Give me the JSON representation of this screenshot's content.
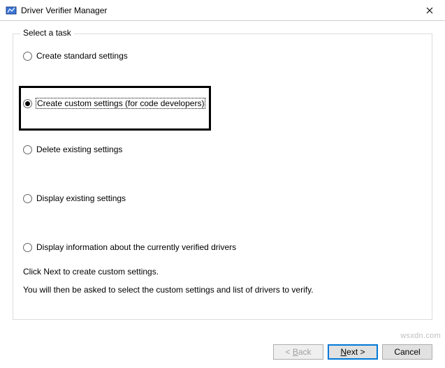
{
  "window": {
    "title": "Driver Verifier Manager"
  },
  "groupbox": {
    "label": "Select a task",
    "options": [
      {
        "label": "Create standard settings",
        "checked": false
      },
      {
        "label": "Create custom settings (for code developers)",
        "checked": true
      },
      {
        "label": "Delete existing settings",
        "checked": false
      },
      {
        "label": "Display existing settings",
        "checked": false
      },
      {
        "label": "Display information about the currently verified drivers",
        "checked": false
      }
    ],
    "selected_index": 1
  },
  "instructions": {
    "line1": "Click Next to create custom settings.",
    "line2": "You will then be asked to select the custom settings and list of drivers to verify."
  },
  "buttons": {
    "back": "< Back",
    "next": "Next >",
    "cancel": "Cancel",
    "back_enabled": false,
    "next_enabled": true,
    "cancel_enabled": true
  },
  "watermark": "wsxdn.com"
}
